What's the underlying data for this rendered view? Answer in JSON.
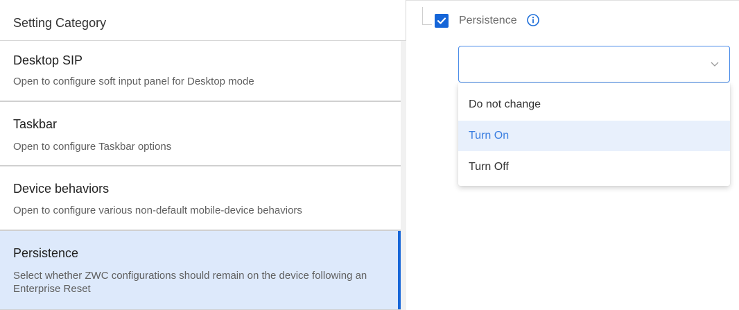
{
  "left_panel": {
    "header": "Setting Category",
    "items": [
      {
        "title": "Desktop SIP",
        "description": "Open to configure soft input panel for Desktop mode",
        "selected": false
      },
      {
        "title": "Taskbar",
        "description": "Open to configure Taskbar options",
        "selected": false
      },
      {
        "title": "Device behaviors",
        "description": "Open to configure various non-default mobile-device behaviors",
        "selected": false
      },
      {
        "title": "Persistence",
        "description": "Select whether ZWC configurations should remain on the device following an Enterprise Reset",
        "selected": true
      }
    ]
  },
  "right_panel": {
    "checkbox_checked": true,
    "setting_label": "Persistence",
    "info_icon": "info-icon",
    "select": {
      "value": "",
      "options": [
        "Do not change",
        "Turn On",
        "Turn Off"
      ],
      "highlighted": "Turn On"
    }
  },
  "colors": {
    "accent": "#1565d8",
    "selected_bg": "#dde9fb",
    "option_highlight_bg": "#e8f0fc",
    "option_highlight_text": "#3a7ee0"
  }
}
